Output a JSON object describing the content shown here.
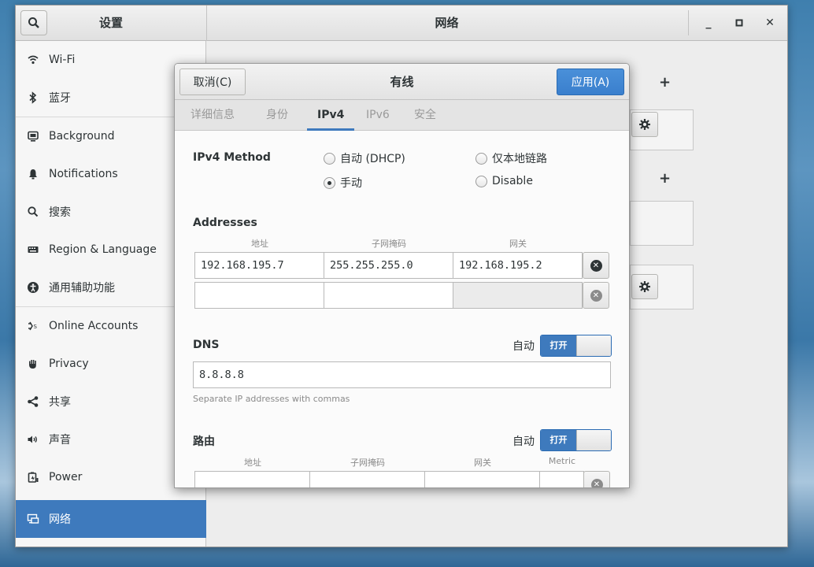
{
  "window": {
    "sidebar_title": "设置",
    "main_title": "网络",
    "controls": {
      "minimize": "_",
      "maximize": "▫",
      "close": "✕"
    }
  },
  "sidebar": {
    "items": [
      {
        "label": "Wi-Fi",
        "icon": "wifi-icon"
      },
      {
        "label": "蓝牙",
        "icon": "bluetooth-icon"
      },
      {
        "label": "Background",
        "icon": "background-icon"
      },
      {
        "label": "Notifications",
        "icon": "bell-icon"
      },
      {
        "label": "搜索",
        "icon": "search-icon"
      },
      {
        "label": "Region & Language",
        "icon": "keyboard-icon"
      },
      {
        "label": "通用辅助功能",
        "icon": "accessibility-icon"
      },
      {
        "label": "Online Accounts",
        "icon": "online-accounts-icon"
      },
      {
        "label": "Privacy",
        "icon": "hand-icon"
      },
      {
        "label": "共享",
        "icon": "share-icon"
      },
      {
        "label": "声音",
        "icon": "speaker-icon"
      },
      {
        "label": "Power",
        "icon": "power-icon"
      },
      {
        "label": "网络",
        "icon": "network-icon",
        "selected": true
      }
    ]
  },
  "main": {
    "add_symbol": "+"
  },
  "dialog": {
    "title": "有线",
    "cancel_label": "取消(C)",
    "apply_label": "应用(A)",
    "tabs": [
      "详细信息",
      "身份",
      "IPv4",
      "IPv6",
      "安全"
    ],
    "active_tab": "IPv4",
    "ipv4_method": {
      "label": "IPv4 Method",
      "options": [
        "自动 (DHCP)",
        "仅本地链路",
        "手动",
        "Disable"
      ],
      "selected": "手动"
    },
    "addresses": {
      "label": "Addresses",
      "headers": [
        "地址",
        "子网掩码",
        "网关"
      ],
      "rows": [
        [
          "192.168.195.7",
          "255.255.255.0",
          "192.168.195.2"
        ],
        [
          "",
          "",
          ""
        ]
      ]
    },
    "dns": {
      "label": "DNS",
      "auto_label": "自动",
      "switch_label": "打开",
      "value": "8.8.8.8",
      "hint": "Separate IP addresses with commas"
    },
    "routes": {
      "label": "路由",
      "auto_label": "自动",
      "switch_label": "打开",
      "headers": [
        "地址",
        "子网掩码",
        "网关",
        "Metric"
      ]
    }
  },
  "colors": {
    "accent": "#3e7abd"
  }
}
